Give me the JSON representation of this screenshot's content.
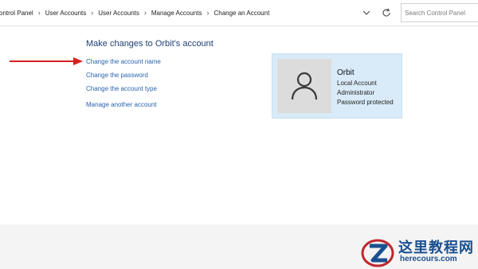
{
  "address_bar": {
    "breadcrumbs": [
      "ontrol Panel",
      "User Accounts",
      "User Accounts",
      "Manage Accounts",
      "Change an Account"
    ],
    "separator": "›",
    "search_placeholder": "Search Control Panel"
  },
  "main": {
    "heading": "Make changes to Orbit's account",
    "links": {
      "change_name": "Change the account name",
      "change_password": "Change the password",
      "change_type": "Change the account type",
      "manage_another": "Manage another account"
    }
  },
  "user_card": {
    "name": "Orbit",
    "details": [
      "Local Account",
      "Administrator",
      "Password protected"
    ]
  },
  "watermark": {
    "text": "这里教程网",
    "url": "herecours.com"
  },
  "colors": {
    "link": "#2863b0",
    "heading": "#1e3e73",
    "card_bg": "#d9ebf8",
    "arrow": "#d62020"
  }
}
